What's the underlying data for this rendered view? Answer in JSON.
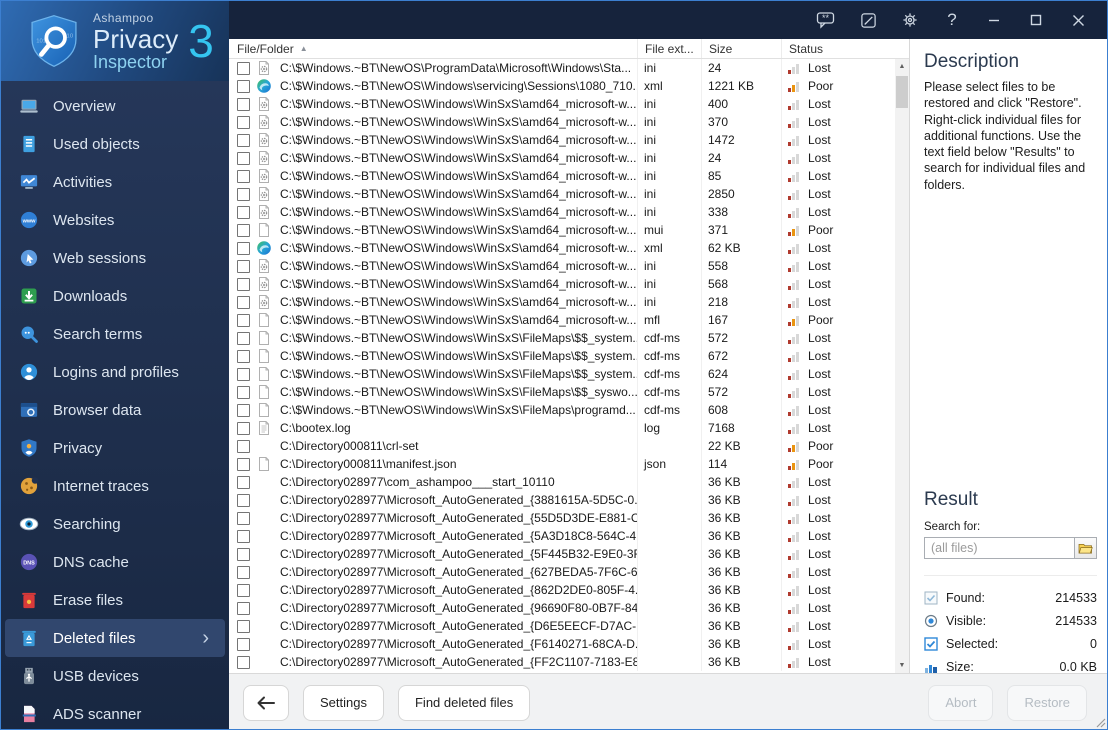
{
  "window": {
    "brand": "Ashampoo",
    "product_line1": "Privacy",
    "product_line2": "Inspector",
    "version": "3"
  },
  "titlebar": {
    "icons": [
      "feedback-icon",
      "notes-icon",
      "settings-icon",
      "help-icon",
      "minimize-icon",
      "maximize-icon",
      "close-icon"
    ],
    "help_label": "?"
  },
  "sidebar": {
    "items": [
      {
        "label": "Overview",
        "icon": "overview",
        "selected": false
      },
      {
        "label": "Used objects",
        "icon": "used-objects",
        "selected": false
      },
      {
        "label": "Activities",
        "icon": "activities",
        "selected": false
      },
      {
        "label": "Websites",
        "icon": "websites",
        "selected": false
      },
      {
        "label": "Web sessions",
        "icon": "web-sessions",
        "selected": false
      },
      {
        "label": "Downloads",
        "icon": "downloads",
        "selected": false
      },
      {
        "label": "Search terms",
        "icon": "search-terms",
        "selected": false
      },
      {
        "label": "Logins and profiles",
        "icon": "logins",
        "selected": false
      },
      {
        "label": "Browser data",
        "icon": "browser-data",
        "selected": false
      },
      {
        "label": "Privacy",
        "icon": "privacy",
        "selected": false
      },
      {
        "label": "Internet traces",
        "icon": "internet-traces",
        "selected": false
      },
      {
        "label": "Searching",
        "icon": "searching",
        "selected": false
      },
      {
        "label": "DNS cache",
        "icon": "dns-cache",
        "selected": false
      },
      {
        "label": "Erase files",
        "icon": "erase-files",
        "selected": false
      },
      {
        "label": "Deleted files",
        "icon": "deleted-files",
        "selected": true
      },
      {
        "label": "USB devices",
        "icon": "usb-devices",
        "selected": false
      },
      {
        "label": "ADS scanner",
        "icon": "ads-scanner",
        "selected": false
      }
    ]
  },
  "table": {
    "columns": [
      "File/Folder",
      "File ext...",
      "Size",
      "Status"
    ],
    "sort_indicator": "▲",
    "rows": [
      {
        "icon": "gear-doc",
        "path": "C:\\$Windows.~BT\\NewOS\\ProgramData\\Microsoft\\Windows\\Sta...",
        "ext": "ini",
        "size": "24",
        "status": "Lost"
      },
      {
        "icon": "edge",
        "path": "C:\\$Windows.~BT\\NewOS\\Windows\\servicing\\Sessions\\1080_710...",
        "ext": "xml",
        "size": "1221 KB",
        "status": "Poor"
      },
      {
        "icon": "gear-doc",
        "path": "C:\\$Windows.~BT\\NewOS\\Windows\\WinSxS\\amd64_microsoft-w...",
        "ext": "ini",
        "size": "400",
        "status": "Lost"
      },
      {
        "icon": "gear-doc",
        "path": "C:\\$Windows.~BT\\NewOS\\Windows\\WinSxS\\amd64_microsoft-w...",
        "ext": "ini",
        "size": "370",
        "status": "Lost"
      },
      {
        "icon": "gear-doc",
        "path": "C:\\$Windows.~BT\\NewOS\\Windows\\WinSxS\\amd64_microsoft-w...",
        "ext": "ini",
        "size": "1472",
        "status": "Lost"
      },
      {
        "icon": "gear-doc",
        "path": "C:\\$Windows.~BT\\NewOS\\Windows\\WinSxS\\amd64_microsoft-w...",
        "ext": "ini",
        "size": "24",
        "status": "Lost"
      },
      {
        "icon": "gear-doc",
        "path": "C:\\$Windows.~BT\\NewOS\\Windows\\WinSxS\\amd64_microsoft-w...",
        "ext": "ini",
        "size": "85",
        "status": "Lost"
      },
      {
        "icon": "gear-doc",
        "path": "C:\\$Windows.~BT\\NewOS\\Windows\\WinSxS\\amd64_microsoft-w...",
        "ext": "ini",
        "size": "2850",
        "status": "Lost"
      },
      {
        "icon": "gear-doc",
        "path": "C:\\$Windows.~BT\\NewOS\\Windows\\WinSxS\\amd64_microsoft-w...",
        "ext": "ini",
        "size": "338",
        "status": "Lost"
      },
      {
        "icon": "doc",
        "path": "C:\\$Windows.~BT\\NewOS\\Windows\\WinSxS\\amd64_microsoft-w...",
        "ext": "mui",
        "size": "371",
        "status": "Poor"
      },
      {
        "icon": "edge",
        "path": "C:\\$Windows.~BT\\NewOS\\Windows\\WinSxS\\amd64_microsoft-w...",
        "ext": "xml",
        "size": "62 KB",
        "status": "Lost"
      },
      {
        "icon": "gear-doc",
        "path": "C:\\$Windows.~BT\\NewOS\\Windows\\WinSxS\\amd64_microsoft-w...",
        "ext": "ini",
        "size": "558",
        "status": "Lost"
      },
      {
        "icon": "gear-doc",
        "path": "C:\\$Windows.~BT\\NewOS\\Windows\\WinSxS\\amd64_microsoft-w...",
        "ext": "ini",
        "size": "568",
        "status": "Lost"
      },
      {
        "icon": "gear-doc",
        "path": "C:\\$Windows.~BT\\NewOS\\Windows\\WinSxS\\amd64_microsoft-w...",
        "ext": "ini",
        "size": "218",
        "status": "Lost"
      },
      {
        "icon": "doc",
        "path": "C:\\$Windows.~BT\\NewOS\\Windows\\WinSxS\\amd64_microsoft-w...",
        "ext": "mfl",
        "size": "167",
        "status": "Poor"
      },
      {
        "icon": "doc",
        "path": "C:\\$Windows.~BT\\NewOS\\Windows\\WinSxS\\FileMaps\\$$_system...",
        "ext": "cdf-ms",
        "size": "572",
        "status": "Lost"
      },
      {
        "icon": "doc",
        "path": "C:\\$Windows.~BT\\NewOS\\Windows\\WinSxS\\FileMaps\\$$_system...",
        "ext": "cdf-ms",
        "size": "672",
        "status": "Lost"
      },
      {
        "icon": "doc",
        "path": "C:\\$Windows.~BT\\NewOS\\Windows\\WinSxS\\FileMaps\\$$_system...",
        "ext": "cdf-ms",
        "size": "624",
        "status": "Lost"
      },
      {
        "icon": "doc",
        "path": "C:\\$Windows.~BT\\NewOS\\Windows\\WinSxS\\FileMaps\\$$_syswo...",
        "ext": "cdf-ms",
        "size": "572",
        "status": "Lost"
      },
      {
        "icon": "doc",
        "path": "C:\\$Windows.~BT\\NewOS\\Windows\\WinSxS\\FileMaps\\programd...",
        "ext": "cdf-ms",
        "size": "608",
        "status": "Lost"
      },
      {
        "icon": "log",
        "path": "C:\\bootex.log",
        "ext": "log",
        "size": "7168",
        "status": "Lost"
      },
      {
        "icon": "none",
        "path": "C:\\Directory000811\\crl-set",
        "ext": "",
        "size": "22 KB",
        "status": "Poor"
      },
      {
        "icon": "doc",
        "path": "C:\\Directory000811\\manifest.json",
        "ext": "json",
        "size": "114",
        "status": "Poor"
      },
      {
        "icon": "none",
        "path": "C:\\Directory028977\\com_ashampoo___start_10110",
        "ext": "",
        "size": "36 KB",
        "status": "Lost"
      },
      {
        "icon": "none",
        "path": "C:\\Directory028977\\Microsoft_AutoGenerated_{3881615A-5D5C-0...",
        "ext": "",
        "size": "36 KB",
        "status": "Lost"
      },
      {
        "icon": "none",
        "path": "C:\\Directory028977\\Microsoft_AutoGenerated_{55D5D3DE-E881-C...",
        "ext": "",
        "size": "36 KB",
        "status": "Lost"
      },
      {
        "icon": "none",
        "path": "C:\\Directory028977\\Microsoft_AutoGenerated_{5A3D18C8-564C-4...",
        "ext": "",
        "size": "36 KB",
        "status": "Lost"
      },
      {
        "icon": "none",
        "path": "C:\\Directory028977\\Microsoft_AutoGenerated_{5F445B32-E9E0-3F...",
        "ext": "",
        "size": "36 KB",
        "status": "Lost"
      },
      {
        "icon": "none",
        "path": "C:\\Directory028977\\Microsoft_AutoGenerated_{627BEDA5-7F6C-6...",
        "ext": "",
        "size": "36 KB",
        "status": "Lost"
      },
      {
        "icon": "none",
        "path": "C:\\Directory028977\\Microsoft_AutoGenerated_{862D2DE0-805F-4...",
        "ext": "",
        "size": "36 KB",
        "status": "Lost"
      },
      {
        "icon": "none",
        "path": "C:\\Directory028977\\Microsoft_AutoGenerated_{96690F80-0B7F-84...",
        "ext": "",
        "size": "36 KB",
        "status": "Lost"
      },
      {
        "icon": "none",
        "path": "C:\\Directory028977\\Microsoft_AutoGenerated_{D6E5EECF-D7AC-...",
        "ext": "",
        "size": "36 KB",
        "status": "Lost"
      },
      {
        "icon": "none",
        "path": "C:\\Directory028977\\Microsoft_AutoGenerated_{F6140271-68CA-D...",
        "ext": "",
        "size": "36 KB",
        "status": "Lost"
      },
      {
        "icon": "none",
        "path": "C:\\Directory028977\\Microsoft_AutoGenerated_{FF2C1107-7183-E8...",
        "ext": "",
        "size": "36 KB",
        "status": "Lost"
      }
    ]
  },
  "description": {
    "title": "Description",
    "body": "Please select files to be restored and click \"Restore\". Right-click individual files for additional functions. Use the text field below \"Results\" to search for individual files and folders."
  },
  "result": {
    "title": "Result",
    "search_label": "Search for:",
    "search_placeholder": "(all files)",
    "stats": [
      {
        "icon": "found",
        "label": "Found:",
        "value": "214533"
      },
      {
        "icon": "visible",
        "label": "Visible:",
        "value": "214533"
      },
      {
        "icon": "selected",
        "label": "Selected:",
        "value": "0"
      },
      {
        "icon": "size",
        "label": "Size:",
        "value": "0.0 KB"
      }
    ]
  },
  "footer": {
    "settings": "Settings",
    "find": "Find deleted files",
    "abort": "Abort",
    "restore": "Restore"
  },
  "colors": {
    "accent": "#35c5f0",
    "status_lost": "#b03a2e",
    "status_poor": "#ea9410",
    "titlebar_bg": "#16233c",
    "sidebar_bg": "#20304f",
    "selected_item_bg": "#31476e"
  }
}
